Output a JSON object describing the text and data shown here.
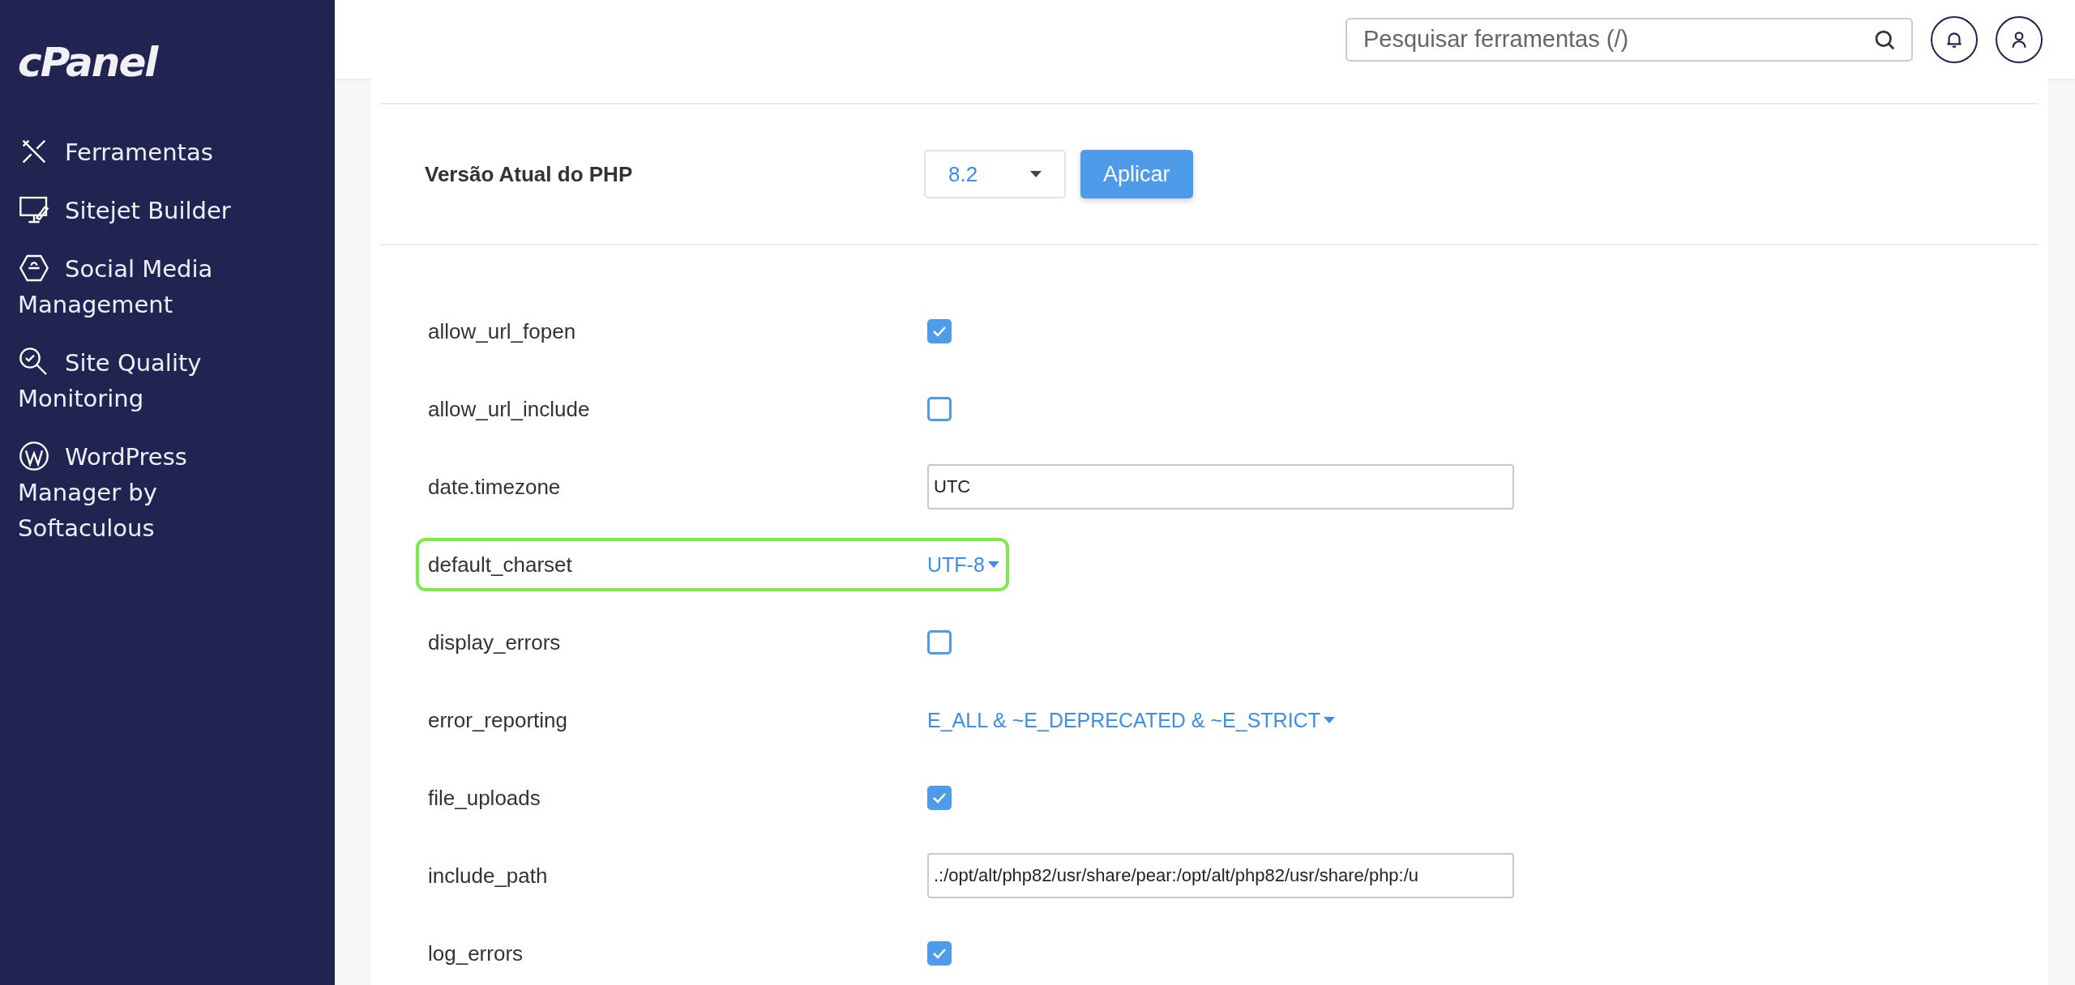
{
  "sidebar": {
    "logo": "cPanel",
    "items": [
      {
        "label": "Ferramentas"
      },
      {
        "label": "Sitejet Builder"
      },
      {
        "label": "Social Media Management"
      },
      {
        "label": "Site Quality Monitoring"
      },
      {
        "label": "WordPress Manager by Softaculous"
      }
    ]
  },
  "header": {
    "search": {
      "placeholder": "Pesquisar ferramentas (/)"
    }
  },
  "php_version": {
    "label": "Versão Atual do PHP",
    "value": "8.2",
    "apply": "Aplicar"
  },
  "settings": [
    {
      "name": "allow_url_fopen",
      "kind": "checkbox",
      "checked": true,
      "highlighted": false
    },
    {
      "name": "allow_url_include",
      "kind": "checkbox",
      "checked": false,
      "highlighted": false
    },
    {
      "name": "date.timezone",
      "kind": "text",
      "value": "UTC",
      "highlighted": false
    },
    {
      "name": "default_charset",
      "kind": "select",
      "value": "UTF-8",
      "highlighted": true
    },
    {
      "name": "display_errors",
      "kind": "checkbox",
      "checked": false,
      "highlighted": false
    },
    {
      "name": "error_reporting",
      "kind": "select",
      "value": "E_ALL & ~E_DEPRECATED & ~E_STRICT",
      "highlighted": false
    },
    {
      "name": "file_uploads",
      "kind": "checkbox",
      "checked": true,
      "highlighted": false
    },
    {
      "name": "include_path",
      "kind": "text",
      "value": ".:/opt/alt/php82/usr/share/pear:/opt/alt/php82/usr/share/php:/u",
      "highlighted": false
    },
    {
      "name": "log_errors",
      "kind": "checkbox",
      "checked": true,
      "highlighted": false
    }
  ]
}
